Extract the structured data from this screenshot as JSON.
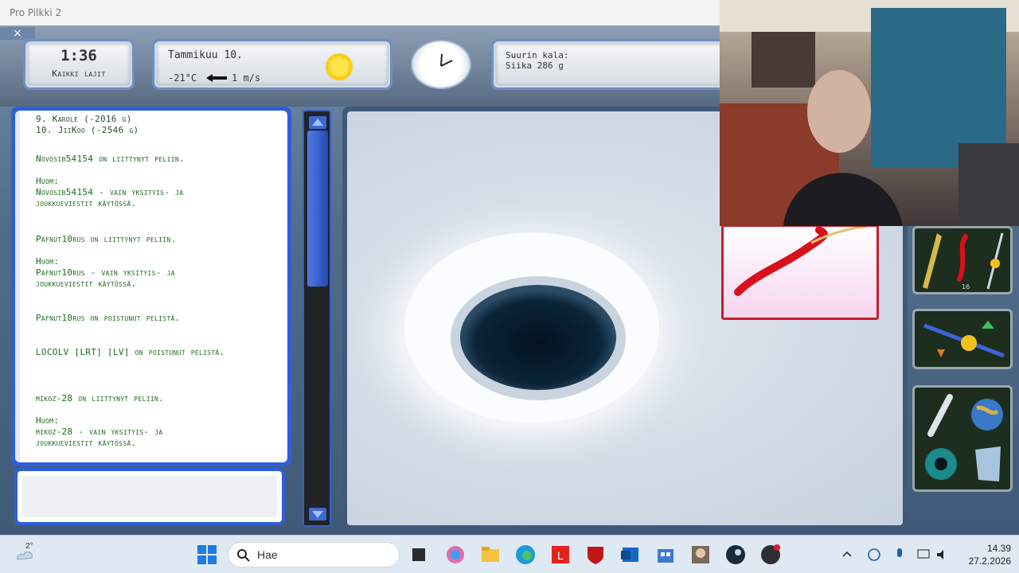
{
  "window": {
    "title": "Pro Pilkki 2",
    "close_glyph": "×"
  },
  "hud": {
    "time": "1:36",
    "species_filter": "Kaikki lajit",
    "date": "Tammikuu 10.",
    "temperature": "-21°C",
    "wind": "1 m/s",
    "weather_icon": "sun-icon",
    "catch_label": "Suurin kala:",
    "catch_value": "Siika 286 g"
  },
  "chat": {
    "ranking": [
      "9. Karole (-2016 g)",
      "10. JiiKoo (-2546 g)"
    ],
    "messages": [
      "Novosib54154 on liittynyt peliin.",
      "Huom:",
      "Novosib54154 - vain yksityis- ja",
      "joukkueviestit käytössä.",
      "Pafnut10rus on liittynyt peliin.",
      "Huom:",
      "Pafnut10rus - vain yksityis- ja",
      "joukkueviestit käytössä.",
      "Pafnut10rus on poistunut pelistä.",
      "LOCOLV [LRT] [LV] on poistunut pelistä.",
      "mikoz-28 on liittynyt peliin.",
      "Huom:",
      "mikoz-28 - vain yksityis- ja",
      "joukkueviestit käytössä."
    ],
    "input_value": ""
  },
  "tools": {
    "lure_count": "16"
  },
  "taskbar": {
    "search_label": "Hae",
    "weather_temp": "2°",
    "time": "14.39",
    "date": "27.2.2026"
  },
  "colors": {
    "chat_text": "#1e6a1e",
    "frame_blue": "#2f5fd8",
    "lure_border": "#c41f2c"
  }
}
